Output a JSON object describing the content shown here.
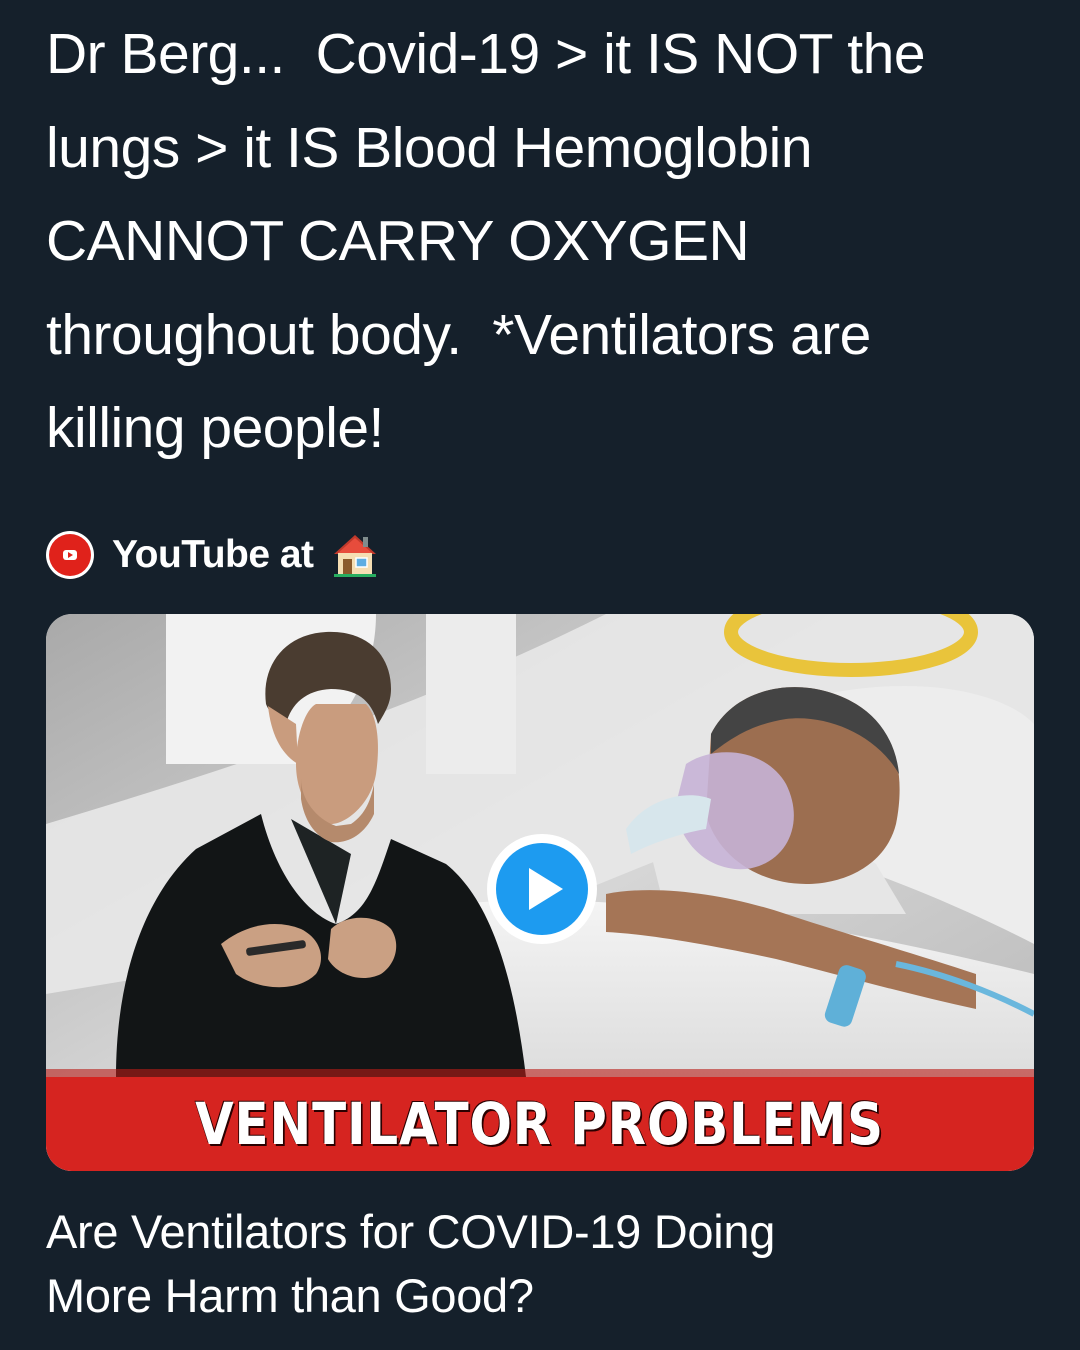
{
  "tweet": {
    "text_lines": [
      "Dr Berg...  Covid-19 > it IS NOT the",
      "lungs > it IS Blood Hemoglobin",
      "CANNOT CARRY OXYGEN",
      "throughout body.  *Ventilators are",
      "killing people!"
    ]
  },
  "source": {
    "icon": "youtube-icon",
    "label": "YouTube at",
    "emoji_icon": "house-icon"
  },
  "media": {
    "thumbnail_caption": "VENTILATOR PROBLEMS",
    "play_icon": "play-icon"
  },
  "video_title": {
    "lines": [
      "Are Ventilators for COVID-19 Doing",
      "More Harm than Good?"
    ]
  },
  "colors": {
    "background": "#15202b",
    "text": "#ffffff",
    "play_blue": "#1d9bf0",
    "banner_red": "#d62420",
    "youtube_red": "#e0221b"
  }
}
